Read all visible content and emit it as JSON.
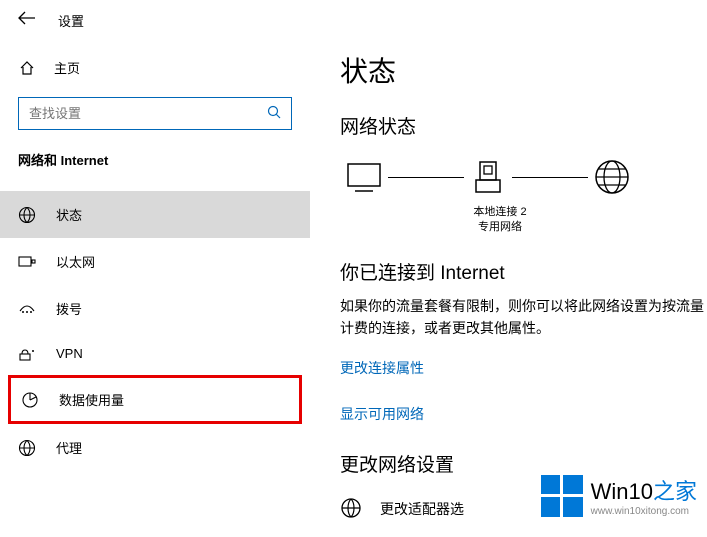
{
  "header": {
    "title": "设置"
  },
  "sidebar": {
    "home_label": "主页",
    "search_placeholder": "查找设置",
    "category": "网络和 Internet",
    "items": [
      {
        "label": "状态",
        "icon": "status"
      },
      {
        "label": "以太网",
        "icon": "ethernet"
      },
      {
        "label": "拨号",
        "icon": "dialup"
      },
      {
        "label": "VPN",
        "icon": "vpn"
      },
      {
        "label": "数据使用量",
        "icon": "data-usage"
      },
      {
        "label": "代理",
        "icon": "proxy"
      }
    ]
  },
  "main": {
    "page_title": "状态",
    "net_status_title": "网络状态",
    "diagram": {
      "conn_name": "本地连接 2",
      "conn_type": "专用网络"
    },
    "connected_heading": "你已连接到 Internet",
    "connected_text": "如果你的流量套餐有限制，则你可以将此网络设置为按流量计费的连接，或者更改其他属性。",
    "link_change_props": "更改连接属性",
    "link_show_networks": "显示可用网络",
    "change_settings_title": "更改网络设置",
    "adapter_label": "更改适配器选"
  },
  "watermark": {
    "brand_main": "Win10",
    "brand_suffix": "之家",
    "url": "www.win10xitong.com"
  }
}
